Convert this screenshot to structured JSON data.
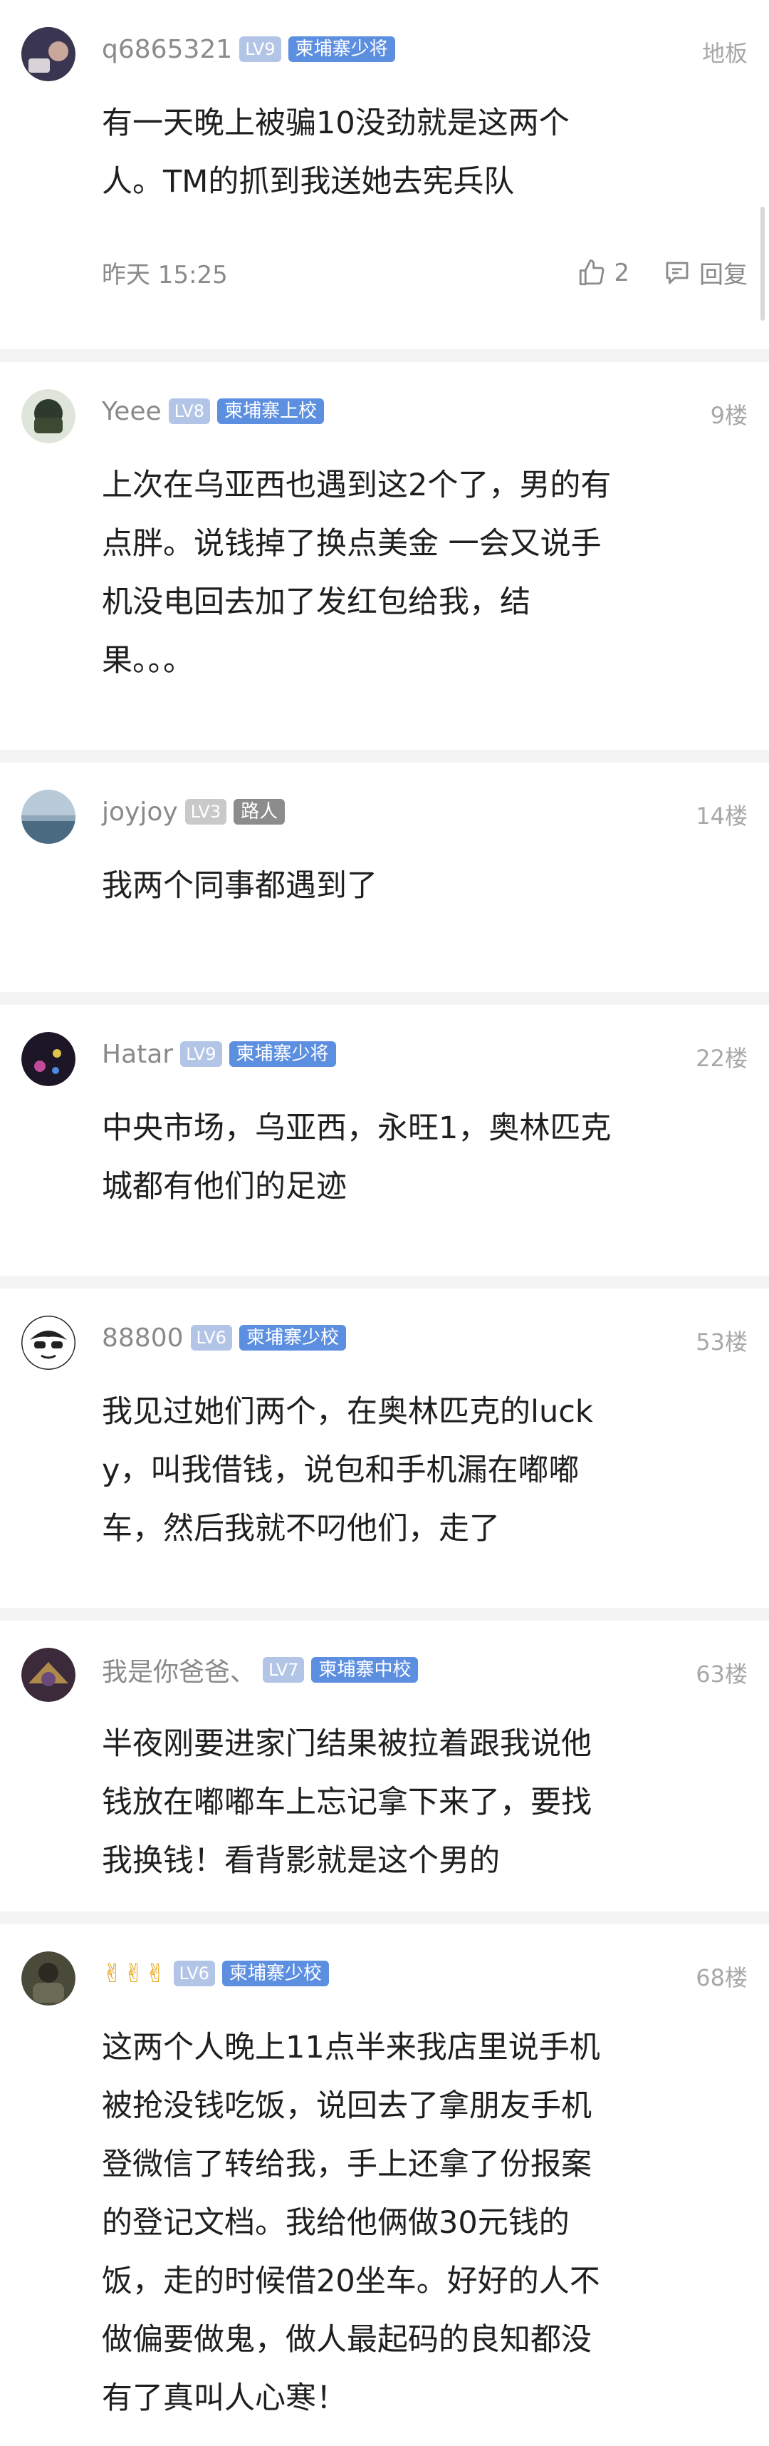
{
  "posts": [
    {
      "username": "q6865321",
      "level": "LV9",
      "rank": "柬埔寨少将",
      "floor": "地板",
      "content": "有一天晚上被骗10没劲就是这两个\n人。TM的抓到我送她去宪兵队",
      "time": "昨天 15:25",
      "likes": "2",
      "reply_label": "回复"
    },
    {
      "username": "Yeee",
      "level": "LV8",
      "rank": "柬埔寨上校",
      "floor": "9楼",
      "content": "上次在乌亚西也遇到这2个了，男的有\n点胖。说钱掉了换点美金 一会又说手\n机没电回去加了发红包给我，结\n果。。。"
    },
    {
      "username": "joyjoy",
      "level": "LV3",
      "rank": "路人",
      "floor": "14楼",
      "content": "我两个同事都遇到了"
    },
    {
      "username": "Hatar",
      "level": "LV9",
      "rank": "柬埔寨少将",
      "floor": "22楼",
      "content": "中央市场，乌亚西，永旺1，奥林匹克\n城都有他们的足迹"
    },
    {
      "username": "88800",
      "level": "LV6",
      "rank": "柬埔寨少校",
      "floor": "53楼",
      "content": "我见过她们两个，在奥林匹克的luck\ny，叫我借钱，说包和手机漏在嘟嘟\n车，然后我就不叼他们，走了"
    },
    {
      "username": "我是你爸爸、",
      "level": "LV7",
      "rank": "柬埔寨中校",
      "floor": "63楼",
      "content": "半夜刚要进家门结果被拉着跟我说他\n钱放在嘟嘟车上忘记拿下来了，要找\n我换钱！看背影就是这个男的"
    },
    {
      "username": "✌✌✌",
      "level": "LV6",
      "rank": "柬埔寨少校",
      "floor": "68楼",
      "content": "这两个人晚上11点半来我店里说手机\n被抢没钱吃饭，说回去了拿朋友手机\n登微信了转给我，手上还拿了份报案\n的登记文档。我给他俩做30元钱的\n饭，走的时候借20坐车。好好的人不\n做偏要做鬼，做人最起码的良知都没\n有了真叫人心寒！"
    }
  ],
  "colors": {
    "rank_badge": "#5d8fe0",
    "level_badge": "#b3c5e6",
    "muted_text": "#8a8a8a"
  }
}
